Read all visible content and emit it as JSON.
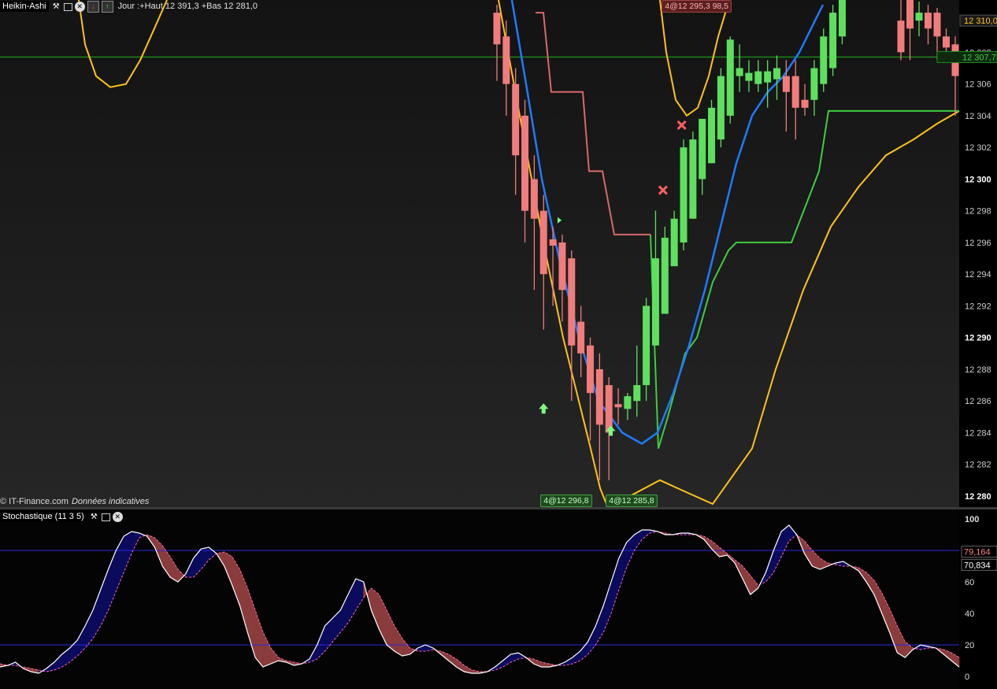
{
  "header": {
    "title": "Heikin-Ashi",
    "info": "Jour :+Haut 12 391,3 +Bas 12 281,0"
  },
  "credit": {
    "source": "© IT-Finance.com",
    "note": "Données indicatives"
  },
  "colors": {
    "bull": "#5ee05e",
    "bear": "#f07c7c",
    "bollinger": "#ffc21a",
    "ma": "#1e7bff",
    "stop_red": "#d86868",
    "stop_green": "#3fcc3f",
    "hline": "#1c8c1c",
    "stoch_k": "#ffffff",
    "stoch_d": "#ff66aa",
    "fill_up": "#0b0b5e",
    "fill_down": "#8a3b3b",
    "stoch_level": "#2a2adf"
  },
  "annotations": [
    {
      "text": "4@12 295,3 98,5",
      "style": "red",
      "x": 18,
      "y": 12311.1
    },
    {
      "text": "4@12 296,8",
      "style": "green",
      "x": 5,
      "y": 12279.6
    },
    {
      "text": "4@12 285,8",
      "style": "green",
      "x": 12,
      "y": 12279.6
    }
  ],
  "chart_data": [
    {
      "type": "candlestick",
      "title": "Heikin-Ashi",
      "ylim": [
        12279.5,
        12311.3
      ],
      "y_ticks": [
        "12 280",
        "12 282",
        "12 284",
        "12 286",
        "12 288",
        "12 290",
        "12 292",
        "12 294",
        "12 296",
        "12 298",
        "12 300",
        "12 302",
        "12 304",
        "12 306",
        "12 308"
      ],
      "last_price_label": "12 310,0",
      "price_line_label": "12 307,7",
      "price_line_value": 12307.7,
      "candles": [
        {
          "o": 12310.5,
          "c": 12308.5,
          "h": 12311.0,
          "l": 12306.2
        },
        {
          "o": 12309.0,
          "c": 12306.0,
          "h": 12310.0,
          "l": 12304.0
        },
        {
          "o": 12306.0,
          "c": 12301.5,
          "h": 12307.0,
          "l": 12299.0
        },
        {
          "o": 12304.0,
          "c": 12298.0,
          "h": 12305.0,
          "l": 12296.0
        },
        {
          "o": 12300.0,
          "c": 12297.5,
          "h": 12301.5,
          "l": 12293.0
        },
        {
          "o": 12298.0,
          "c": 12294.0,
          "h": 12299.0,
          "l": 12290.5
        },
        {
          "o": 12296.2,
          "c": 12295.8,
          "h": 12297.0,
          "l": 12292.0
        },
        {
          "o": 12296.0,
          "c": 12293.0,
          "h": 12296.5,
          "l": 12291.0
        },
        {
          "o": 12295.0,
          "c": 12289.5,
          "h": 12295.5,
          "l": 12286.0
        },
        {
          "o": 12291.0,
          "c": 12289.0,
          "h": 12292.0,
          "l": 12287.5
        },
        {
          "o": 12289.5,
          "c": 12286.5,
          "h": 12290.0,
          "l": 12283.5
        },
        {
          "o": 12288.0,
          "c": 12284.5,
          "h": 12289.0,
          "l": 12281.0
        },
        {
          "o": 12287.0,
          "c": 12284.0,
          "h": 12287.5,
          "l": 12281.0
        },
        {
          "o": 12285.8,
          "c": 12285.6,
          "h": 12286.8,
          "l": 12284.5
        },
        {
          "o": 12285.5,
          "c": 12286.3,
          "h": 12286.5,
          "l": 12284.8
        },
        {
          "o": 12286.0,
          "c": 12287.0,
          "h": 12289.5,
          "l": 12285.0
        },
        {
          "o": 12287.0,
          "c": 12292.0,
          "h": 12292.5,
          "l": 12286.0
        },
        {
          "o": 12289.5,
          "c": 12295.0,
          "h": 12298.0,
          "l": 12289.5
        },
        {
          "o": 12291.5,
          "c": 12296.3,
          "h": 12297.0,
          "l": 12291.5
        },
        {
          "o": 12294.5,
          "c": 12297.5,
          "h": 12298.0,
          "l": 12294.5
        },
        {
          "o": 12296.0,
          "c": 12302.0,
          "h": 12302.5,
          "l": 12295.5
        },
        {
          "o": 12297.5,
          "c": 12302.5,
          "h": 12303.0,
          "l": 12297.5
        },
        {
          "o": 12300.0,
          "c": 12303.8,
          "h": 12303.8,
          "l": 12299.0
        },
        {
          "o": 12301.0,
          "c": 12304.5,
          "h": 12305.0,
          "l": 12301.0
        },
        {
          "o": 12302.5,
          "c": 12306.5,
          "h": 12307.0,
          "l": 12302.0
        },
        {
          "o": 12304.0,
          "c": 12308.8,
          "h": 12309.0,
          "l": 12303.5
        },
        {
          "o": 12306.5,
          "c": 12307.0,
          "h": 12308.5,
          "l": 12305.5
        },
        {
          "o": 12306.2,
          "c": 12306.7,
          "h": 12307.5,
          "l": 12305.5
        },
        {
          "o": 12306.0,
          "c": 12306.8,
          "h": 12307.5,
          "l": 12305.5
        },
        {
          "o": 12306.1,
          "c": 12306.8,
          "h": 12307.5,
          "l": 12304.5
        },
        {
          "o": 12306.3,
          "c": 12307.0,
          "h": 12307.8,
          "l": 12305.0
        },
        {
          "o": 12306.5,
          "c": 12305.5,
          "h": 12307.5,
          "l": 12303.0
        },
        {
          "o": 12306.5,
          "c": 12304.5,
          "h": 12307.5,
          "l": 12302.5
        },
        {
          "o": 12305.0,
          "c": 12304.5,
          "h": 12306.0,
          "l": 12304.0
        },
        {
          "o": 12305.0,
          "c": 12307.0,
          "h": 12307.5,
          "l": 12304.0
        },
        {
          "o": 12306.0,
          "c": 12309.0,
          "h": 12309.5,
          "l": 12305.5
        },
        {
          "o": 12307.0,
          "c": 12310.5,
          "h": 12311.0,
          "l": 12306.5
        },
        {
          "o": 12309.0,
          "c": 12311.5,
          "h": 12311.5,
          "l": 12308.5
        }
      ],
      "candles_right": [
        {
          "o": 12310.0,
          "c": 12308.0,
          "h": 12311.5,
          "l": 12307.5
        },
        {
          "o": 12311.5,
          "c": 12309.5,
          "h": 12311.5,
          "l": 12307.5
        },
        {
          "o": 12310.0,
          "c": 12310.5,
          "h": 12311.2,
          "l": 12309.0
        },
        {
          "o": 12310.5,
          "c": 12309.5,
          "h": 12311.0,
          "l": 12308.5
        },
        {
          "o": 12310.5,
          "c": 12309.0,
          "h": 12310.8,
          "l": 12307.5
        },
        {
          "o": 12309.0,
          "c": 12308.3,
          "h": 12309.5,
          "l": 12307.8
        },
        {
          "o": 12308.5,
          "c": 12306.5,
          "h": 12309.0,
          "l": 12304.0
        }
      ],
      "bollinger_upper": {
        "left": [
          12311.3,
          12308.5,
          12306.5,
          12305.8,
          12306.0,
          12307.5,
          12309.5,
          12311.3
        ],
        "right": [
          12311.3,
          12308.0,
          12305.0,
          12304.0,
          12304.5,
          12306.5,
          12309.0,
          12311.3
        ]
      },
      "bollinger_lower": [
        12311.3,
        12304.0,
        12296.0,
        12290.0,
        12286.0,
        12283.0,
        12280.5,
        12279.5,
        12280.0,
        12281.0,
        12280.5,
        12279.5,
        12283.0,
        12288.0,
        12293.0,
        12297.0,
        12299.5,
        12301.5,
        12302.5,
        12303.5,
        12304.3
      ],
      "moving_average": [
        12311.3,
        12306.0,
        12300.0,
        12295.0,
        12290.0,
        12286.0,
        12284.0,
        12283.3,
        12284.0,
        12286.5,
        12289.5,
        12293.0,
        12297.0,
        12301.0,
        12304.0,
        12305.5,
        12306.5,
        12308.0,
        12309.5,
        12311.0
      ],
      "stop_red": [
        12310.5,
        12310.5,
        12305.5,
        12305.5,
        12305.5,
        12300.5,
        12300.5,
        12296.5,
        12296.5,
        12296.5,
        12296.5
      ],
      "stop_green": [
        12296.5,
        12283.0,
        12285.0,
        12289.0,
        12290.0,
        12293.5,
        12295.5,
        12296.0,
        12296.0,
        12296.0,
        12300.5,
        12304.3,
        12304.3,
        12304.3,
        12304.3,
        12304.3,
        12304.3,
        12304.3
      ],
      "markers": [
        {
          "kind": "arrow-up",
          "x": 5.0,
          "y": 12285.5
        },
        {
          "kind": "arrow-up",
          "x": 12.2,
          "y": 12284.1
        },
        {
          "kind": "cross",
          "x": 17.8,
          "y": 12299.3
        },
        {
          "kind": "cross",
          "x": 19.8,
          "y": 12303.4
        },
        {
          "kind": "tri",
          "x": 6.5,
          "y": 12297.4
        }
      ]
    },
    {
      "type": "line",
      "title": "Stochastique (11 3 5)",
      "ylim": [
        -2,
        102
      ],
      "y_ticks": [
        "0",
        "20",
        "40",
        "60",
        "100"
      ],
      "levels": [
        20,
        80
      ],
      "k_label": "79,164",
      "d_label": "70,834",
      "k_last": 79.164,
      "d_last": 70.834,
      "series": [
        {
          "name": "%K",
          "values": [
            6,
            7,
            9,
            5,
            3,
            2,
            5,
            9,
            14,
            18,
            23,
            32,
            42,
            55,
            68,
            80,
            89,
            92,
            91,
            89,
            82,
            70,
            63,
            60,
            65,
            75,
            81,
            82,
            78,
            70,
            58,
            45,
            28,
            12,
            6,
            8,
            10,
            9,
            7,
            8,
            11,
            20,
            32,
            37,
            42,
            52,
            62,
            60,
            42,
            30,
            20,
            16,
            13,
            14,
            18,
            20,
            18,
            14,
            10,
            6,
            3,
            2,
            2,
            3,
            6,
            10,
            14,
            15,
            12,
            8,
            6,
            6,
            7,
            9,
            12,
            16,
            22,
            32,
            45,
            60,
            75,
            85,
            90,
            93,
            93,
            92,
            90,
            90,
            91,
            91,
            90,
            87,
            81,
            76,
            77,
            72,
            62,
            52,
            56,
            66,
            80,
            92,
            96,
            90,
            78,
            70,
            68,
            70,
            72,
            73,
            70,
            67,
            60,
            52,
            40,
            28,
            15,
            12,
            17,
            20,
            19,
            18,
            14,
            10,
            6
          ]
        },
        {
          "name": "%D",
          "values": [
            8,
            7,
            7,
            6,
            5,
            4,
            3,
            4,
            6,
            9,
            13,
            18,
            24,
            32,
            42,
            54,
            66,
            78,
            88,
            90,
            88,
            83,
            76,
            68,
            63,
            63,
            68,
            74,
            78,
            79,
            76,
            68,
            56,
            42,
            28,
            18,
            12,
            10,
            9,
            8,
            9,
            11,
            16,
            22,
            28,
            34,
            42,
            50,
            56,
            52,
            42,
            32,
            24,
            18,
            16,
            16,
            17,
            16,
            14,
            11,
            7,
            4,
            3,
            3,
            4,
            6,
            9,
            11,
            12,
            11,
            9,
            8,
            7,
            7,
            8,
            10,
            14,
            20,
            28,
            40,
            55,
            69,
            80,
            87,
            91,
            92,
            91,
            90,
            90,
            90,
            90,
            89,
            86,
            82,
            78,
            74,
            70,
            64,
            58,
            60,
            66,
            76,
            86,
            90,
            86,
            80,
            75,
            72,
            71,
            70,
            70,
            69,
            66,
            61,
            53,
            43,
            32,
            22,
            18,
            17,
            18,
            18,
            17,
            15,
            12
          ]
        }
      ]
    }
  ]
}
